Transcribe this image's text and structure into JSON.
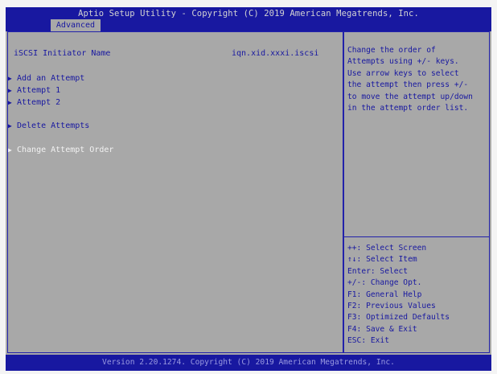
{
  "header": {
    "title": "Aptio Setup Utility - Copyright (C) 2019 American Megatrends, Inc.",
    "active_tab": "Advanced"
  },
  "main": {
    "initiator_label": "iSCSI Initiator Name",
    "initiator_value": "iqn.xid.xxxi.iscsi",
    "items": [
      {
        "label": "Add an Attempt",
        "selected": false
      },
      {
        "label": "Attempt 1",
        "selected": false
      },
      {
        "label": "Attempt 2",
        "selected": false
      },
      {
        "label": "Delete Attempts",
        "selected": false
      },
      {
        "label": "Change Attempt Order",
        "selected": true
      }
    ],
    "arrow_icon": "right-triangle-icon"
  },
  "help": {
    "lines": [
      "Change the order of",
      "Attempts using +/- keys.",
      "Use arrow keys to select",
      "the attempt then press +/-",
      "to move the attempt up/down",
      "in the attempt order list."
    ]
  },
  "keys": [
    "++: Select Screen",
    "↑↓: Select Item",
    "Enter: Select",
    "+/-: Change Opt.",
    "F1: General Help",
    "F2: Previous Values",
    "F3: Optimized Defaults",
    "F4: Save & Exit",
    "ESC: Exit"
  ],
  "footer": {
    "text": "Version 2.20.1274. Copyright (C) 2019 American Megatrends, Inc."
  },
  "colors": {
    "blue": "#1818a0",
    "grey_bg": "#a8a8a8",
    "selected_text": "#f2f2f2"
  }
}
